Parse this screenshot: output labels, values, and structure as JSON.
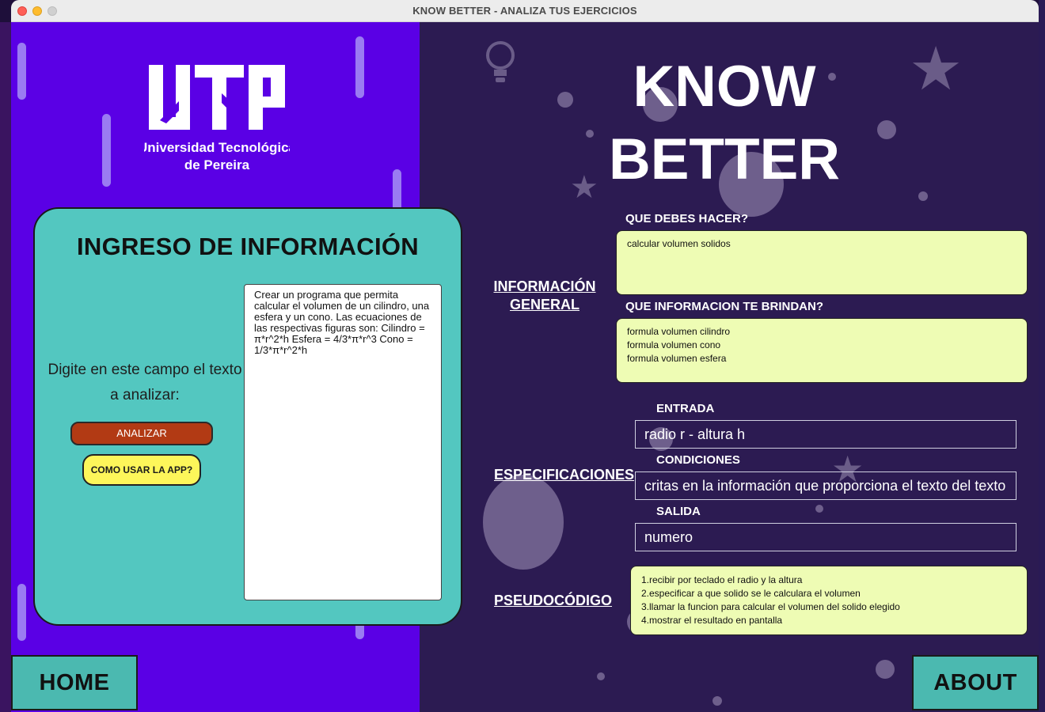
{
  "window": {
    "title": "KNOW BETTER - ANALIZA TUS EJERCICIOS"
  },
  "logo": {
    "name": "UTP",
    "line1": "Universidad Tecnológica",
    "line2": "de Pereira"
  },
  "form": {
    "title": "INGRESO DE INFORMACIÓN",
    "instruction": "Digite en este campo el texto a analizar:",
    "analyze_label": "ANALIZAR",
    "help_label": "COMO USAR LA APP?",
    "input_text": "Crear un programa que permita calcular el volumen de un cilindro, una esfera y un cono. Las ecuaciones de las respectivas figuras son: Cilindro = π*r^2*h Esfera = 4/3*π*r^3 Cono = 1/3*π*r^2*h"
  },
  "nav": {
    "home_label": "HOME",
    "about_label": "ABOUT"
  },
  "app_title": {
    "line1": "KNOW",
    "line2": "BETTER"
  },
  "general_info": {
    "section_label_line1": "INFORMACIÓN",
    "section_label_line2": "GENERAL",
    "task_label": "QUE DEBES HACER?",
    "task_text": "calcular volumen solidos",
    "given_label": "QUE INFORMACION TE BRINDAN?",
    "given_items": [
      "formula volumen cilindro",
      "formula volumen cono",
      "formula volumen esfera"
    ]
  },
  "specs": {
    "section_label": "ESPECIFICACIONES",
    "input_label": "ENTRADA",
    "input_value": "radio r - altura h",
    "conditions_label": "CONDICIONES",
    "conditions_value": "critas en la información que proporciona el texto del texto",
    "output_label": "SALIDA",
    "output_value": "numero"
  },
  "pseudocode": {
    "section_label": "PSEUDOCÓDIGO",
    "steps": [
      "1.recibir por teclado el radio y la altura",
      "2.especificar a que solido se le calculara el volumen",
      "3.llamar la funcion para calcular el volumen del solido elegido",
      "4.mostrar el resultado en pantalla"
    ]
  },
  "colors": {
    "left_panel": "#5a00e5",
    "right_panel": "#2c1b52",
    "card_teal": "#53c7c0",
    "nav_teal": "#4bb9b0",
    "analyze_button": "#b23a14",
    "help_button": "#fdf65a",
    "result_box": "#eefcb4"
  }
}
